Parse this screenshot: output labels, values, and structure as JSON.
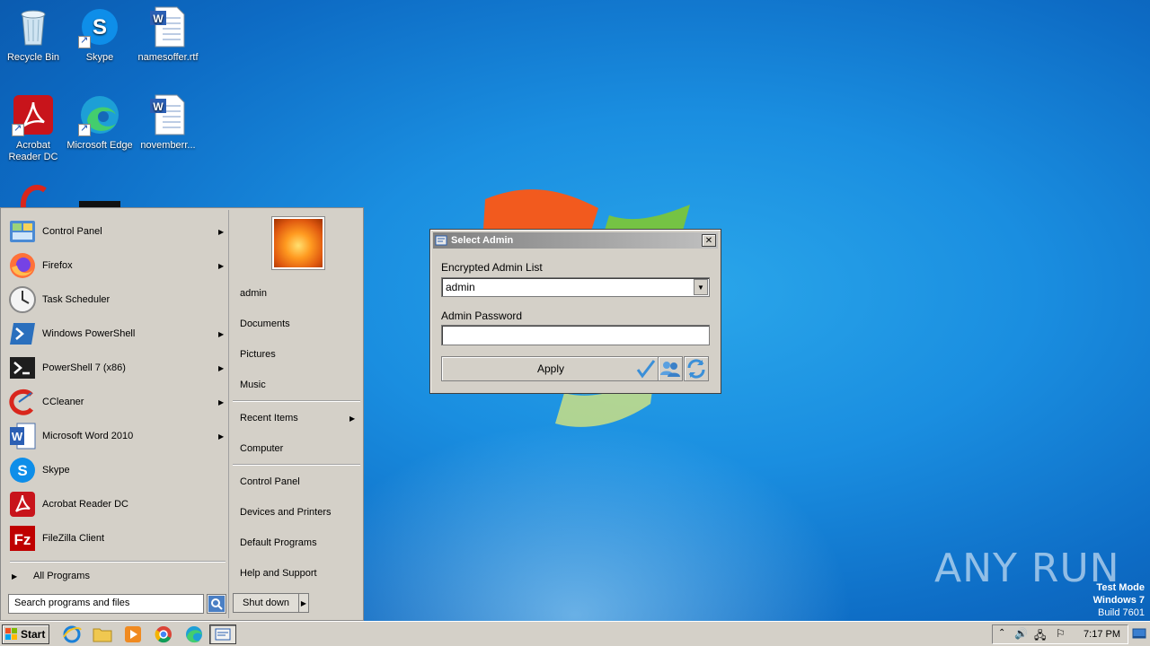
{
  "desktop": {
    "icons": [
      {
        "label": "Recycle Bin"
      },
      {
        "label": "Skype"
      },
      {
        "label": "namesoffer.rtf"
      },
      {
        "label": "Acrobat Reader DC"
      },
      {
        "label": "Microsoft Edge"
      },
      {
        "label": "novemberr..."
      }
    ]
  },
  "start_menu": {
    "programs": [
      {
        "label": "Control Panel",
        "submenu": true
      },
      {
        "label": "Firefox",
        "submenu": true
      },
      {
        "label": "Task Scheduler",
        "submenu": false
      },
      {
        "label": "Windows PowerShell",
        "submenu": true
      },
      {
        "label": "PowerShell 7 (x86)",
        "submenu": true
      },
      {
        "label": "CCleaner",
        "submenu": true
      },
      {
        "label": "Microsoft Word 2010",
        "submenu": true
      },
      {
        "label": "Skype",
        "submenu": false
      },
      {
        "label": "Acrobat Reader DC",
        "submenu": false
      },
      {
        "label": "FileZilla Client",
        "submenu": false
      }
    ],
    "all_programs": "All Programs",
    "search_placeholder": "Search programs and files",
    "right": {
      "user": "admin",
      "items": [
        "Documents",
        "Pictures",
        "Music"
      ],
      "recent_items": "Recent Items",
      "computer": "Computer",
      "items2": [
        "Control Panel",
        "Devices and Printers",
        "Default Programs",
        "Help and Support"
      ]
    },
    "shutdown": "Shut down"
  },
  "dialog": {
    "title": "Select Admin",
    "list_label": "Encrypted Admin List",
    "selected": "admin",
    "password_label": "Admin Password",
    "password_value": "",
    "apply": "Apply"
  },
  "watermark": "ANY RUN",
  "test_mode": {
    "line1": "Test Mode",
    "line2": "Windows 7",
    "line3": "Build 7601"
  },
  "taskbar": {
    "start": "Start",
    "clock": "7:17 PM"
  },
  "colors": {
    "title_bar": "#808080",
    "dialog_bg": "#d4d0c8",
    "desktop": "#1a8ee0"
  }
}
